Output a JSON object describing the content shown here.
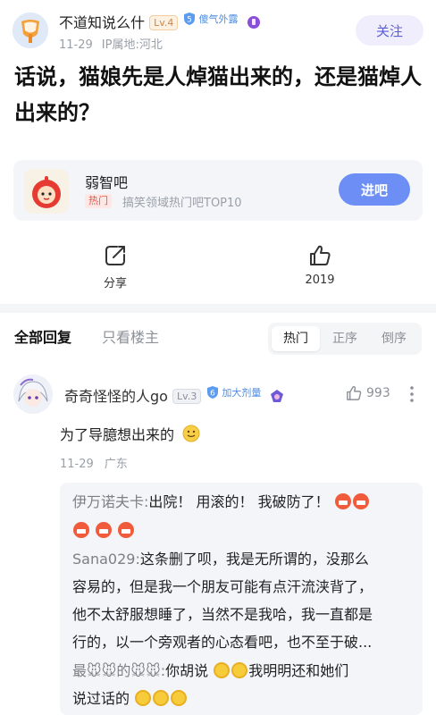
{
  "post": {
    "author": "不道知说么什",
    "author_level": "Lv.4",
    "author_badge_num": "5",
    "author_badge_text": "傻气外露",
    "date": "11-29",
    "ip": "IP属地:河北",
    "follow_label": "关注",
    "title": "话说，猫娘先是人焯猫出来的，还是猫焯人出来的？"
  },
  "forum": {
    "name": "弱智吧",
    "hot_tag": "热门",
    "desc": "搞笑领域热门吧TOP10",
    "enter_label": "进吧"
  },
  "actions": {
    "share_label": "分享",
    "like_count": "2019"
  },
  "replies": {
    "tab_all": "全部回复",
    "tab_op": "只看楼主",
    "sort_hot": "热门",
    "sort_asc": "正序",
    "sort_desc": "倒序"
  },
  "comment": {
    "author": "奇奇怪怪的人go",
    "level": "Lv.3",
    "badge_num": "6",
    "badge_text": "加大剂量",
    "likes": "993",
    "text": "为了导臆想出来的",
    "date": "11-29",
    "location": "广东",
    "sub_replies": [
      {
        "user": "伊万诺夫卡:",
        "text": "出院！ 用滚的！ 我破防了！"
      },
      {
        "user": "Sana029:",
        "text": "这条删了呗，我是无所谓的，没那么"
      },
      {
        "text": "容易的，但是我一个朋友可能有点汗流浃背了，"
      },
      {
        "text": "他不太舒服想睡了，当然不是我哈，我一直都是"
      },
      {
        "text": "行的，以一个旁观者的心态看吧，也不至于破..."
      },
      {
        "user": "最🐭🐭的🐭🐭:",
        "text": "你胡说",
        "text2": "我明明还和她们"
      },
      {
        "text": "说过话的"
      }
    ]
  },
  "colors": {
    "accent": "#5b5fd6",
    "enter_button": "#6d8ff5",
    "badge_blue": "#4f8de0"
  }
}
